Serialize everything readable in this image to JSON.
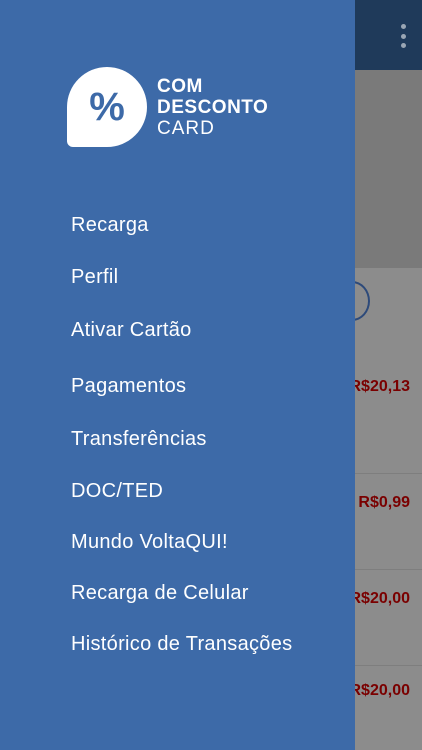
{
  "background": {
    "amounts": [
      "R$20,13",
      "R$0,99",
      "R$20,00",
      "R$20,00"
    ]
  },
  "brand": {
    "badge_symbol": "%",
    "line1": "COM",
    "line2": "DESCONTO",
    "line3": "CARD"
  },
  "menu": {
    "items": [
      "Recarga",
      "Perfil",
      "Ativar Cartão",
      "Pagamentos",
      "Transferências",
      "DOC/TED",
      "Mundo VoltaQUI!",
      "Recarga de Celular",
      "Histórico de Transações"
    ]
  },
  "colors": {
    "drawer": "#3d6aa8",
    "header": "#1f3a5a",
    "amount": "#7a0000"
  }
}
